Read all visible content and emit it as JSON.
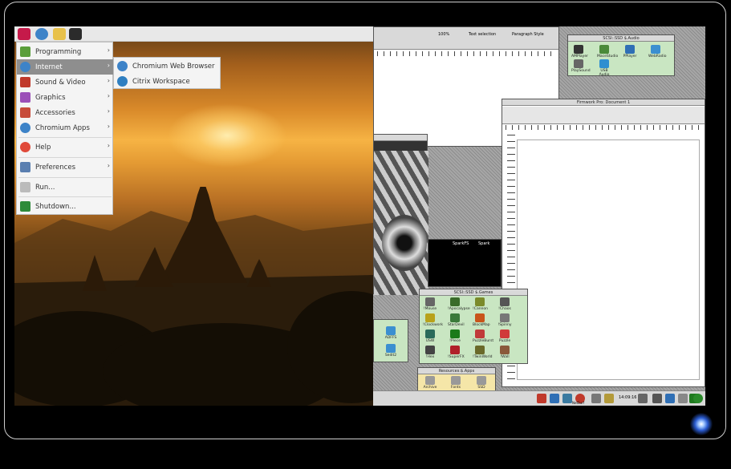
{
  "menu": {
    "items": [
      {
        "label": "Programming",
        "icon": "programming-icon",
        "color": "#5a9e3a",
        "has_submenu": true
      },
      {
        "label": "Internet",
        "icon": "internet-icon",
        "color": "#3d83c8",
        "has_submenu": true,
        "selected": true
      },
      {
        "label": "Sound & Video",
        "icon": "sound-video-icon",
        "color": "#c0392b",
        "has_submenu": true
      },
      {
        "label": "Graphics",
        "icon": "graphics-icon",
        "color": "#9b4fb8",
        "has_submenu": true
      },
      {
        "label": "Accessories",
        "icon": "accessories-icon",
        "color": "#c74b3a",
        "has_submenu": true
      },
      {
        "label": "Chromium Apps",
        "icon": "chromium-icon",
        "color": "#3d83c8",
        "has_submenu": true
      },
      {
        "label": "Help",
        "icon": "help-icon",
        "color": "#e04a3a",
        "has_submenu": true
      },
      {
        "label": "Preferences",
        "icon": "preferences-icon",
        "color": "#5a7fb0",
        "has_submenu": true
      },
      {
        "label": "Run...",
        "icon": "run-icon",
        "color": "#888888",
        "has_submenu": false
      },
      {
        "label": "Shutdown...",
        "icon": "shutdown-icon",
        "color": "#2e8b3a",
        "has_submenu": false
      }
    ]
  },
  "submenu": {
    "items": [
      {
        "label": "Chromium Web Browser",
        "icon": "chromium-icon"
      },
      {
        "label": "Citrix Workspace",
        "icon": "citrix-icon"
      }
    ]
  },
  "riscos": {
    "doc_window_title": "Firmwork Pro: Document 1",
    "top_window_title": "Paragraph Style",
    "zoom": "100%",
    "selection_label": "Text selection",
    "audio_window_title": "SCSI::SSD $.Audio",
    "audio_apps": [
      "AMPlayer",
      "MaceStudio",
      "PPlayer",
      "WebRadio",
      "PlaySound",
      "USB Audio"
    ],
    "games_window_title": "SCSI::SSD $.Games",
    "games_apps": [
      "!Mouse",
      "!Apocalypse",
      "!Cannon",
      "!Chaos",
      "!Clockwork",
      "StarDevil",
      "BlockMap",
      "!Spinny",
      "USW",
      "!Piece",
      "PuzzleBurst",
      "Puzzle",
      "!Hex",
      "!SuperFX",
      "!TwinWorld",
      "!Wall"
    ],
    "resources_window_title": "Resources:$.Apps",
    "resources_apps": [
      "Archive",
      "Fonts",
      "SSD"
    ],
    "left_small_apps": [
      "ADFFS",
      "Sedit2"
    ],
    "sparkfs_tabs": [
      "SparkFS",
      "Spark"
    ],
    "iconbar_label": "NetSurf",
    "clock": "14:09:16"
  }
}
